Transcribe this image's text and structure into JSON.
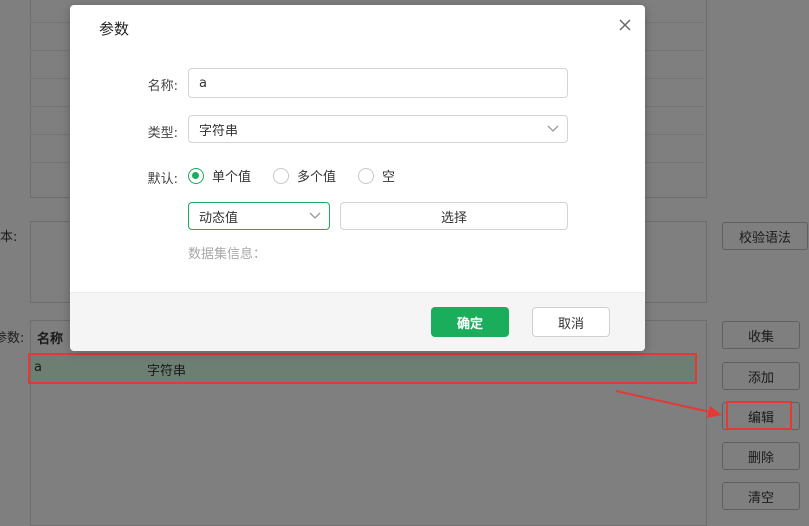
{
  "background": {
    "script_label": "本:",
    "params_label": "参数:",
    "validate_button": "校验语法",
    "table": {
      "columns": [
        "名称"
      ],
      "rows": [
        {
          "name": "a",
          "type": "字符串"
        }
      ]
    },
    "side_buttons": [
      "收集",
      "添加",
      "编辑",
      "删除",
      "清空"
    ]
  },
  "dialog": {
    "title": "参数",
    "name_label": "名称:",
    "name_value": "a",
    "type_label": "类型:",
    "type_value": "字符串",
    "default_label": "默认:",
    "radio_options": [
      "单个值",
      "多个值",
      "空"
    ],
    "radio_selected": "单个值",
    "value_source": "动态值",
    "select_button": "选择",
    "dataset_info_label": "数据集信息：",
    "confirm_button": "确定",
    "cancel_button": "取消"
  },
  "colors": {
    "primary": "#1aad5c",
    "highlight": "#e53935",
    "overlay": "#7f7f7f"
  }
}
